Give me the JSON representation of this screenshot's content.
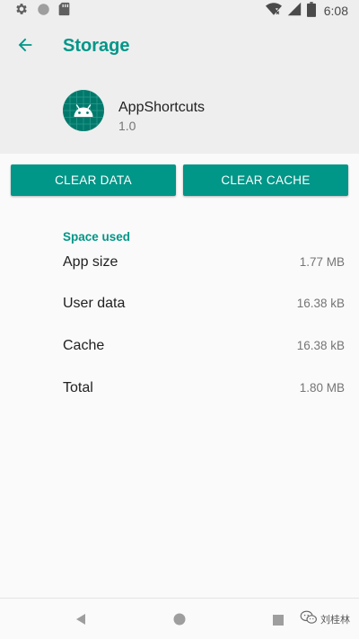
{
  "status_bar": {
    "time": "6:08",
    "icons": [
      "settings-icon",
      "circle-icon",
      "sd-card-icon",
      "wifi-off-icon",
      "signal-icon",
      "battery-icon"
    ]
  },
  "header": {
    "title": "Storage",
    "app_name": "AppShortcuts",
    "app_version": "1.0",
    "icons": [
      "back-arrow-icon",
      "android-robot-icon"
    ]
  },
  "buttons": {
    "clear_data": "CLEAR DATA",
    "clear_cache": "CLEAR CACHE"
  },
  "storage": {
    "section_title": "Space used",
    "rows": [
      {
        "label": "App size",
        "value": "1.77 MB"
      },
      {
        "label": "User data",
        "value": "16.38 kB"
      },
      {
        "label": "Cache",
        "value": "16.38 kB"
      },
      {
        "label": "Total",
        "value": "1.80 MB"
      }
    ]
  },
  "nav_bar": {
    "icons": [
      "back-triangle-icon",
      "home-circle-icon",
      "recents-square-icon"
    ]
  },
  "watermark": {
    "text": "刘桂林"
  },
  "colors": {
    "accent": "#009688",
    "header_background": "#eeeeee",
    "page_background": "#fafafa",
    "primary_text": "#212121",
    "secondary_text": "#757575"
  }
}
